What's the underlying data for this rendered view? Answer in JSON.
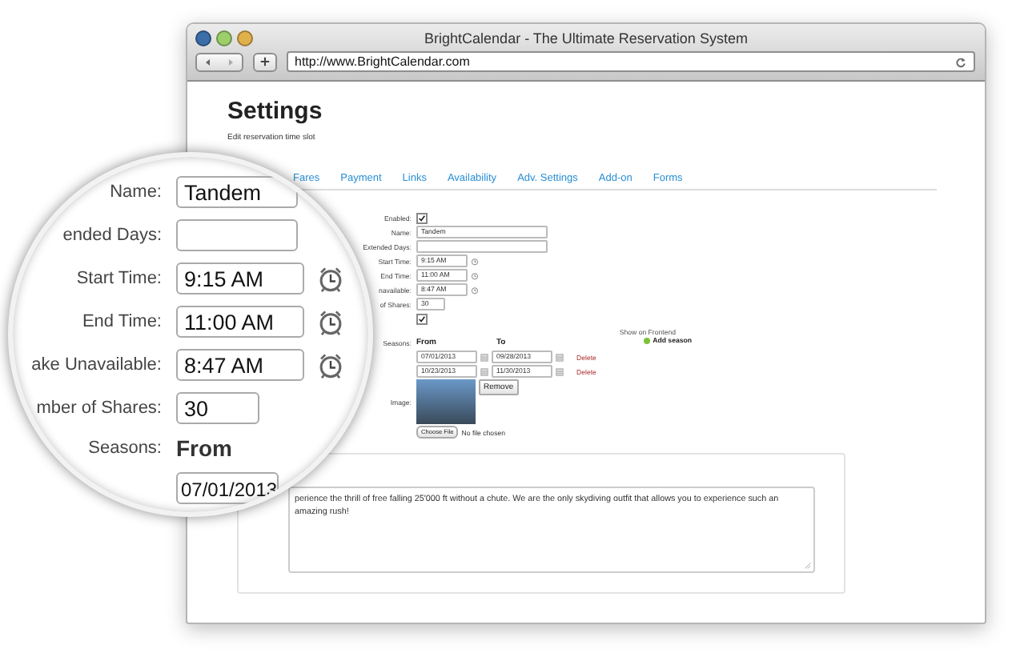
{
  "window": {
    "title": "BrightCalendar - The Ultimate Reservation System",
    "url": "http://www.BrightCalendar.com"
  },
  "page": {
    "heading": "Settings",
    "subtitle": "Edit reservation time slot"
  },
  "tabs": [
    {
      "label": "Fares",
      "selected": false
    },
    {
      "label": "Payment",
      "selected": false
    },
    {
      "label": "Links",
      "selected": false
    },
    {
      "label": "Availability",
      "selected": false
    },
    {
      "label": "Adv. Settings",
      "selected": false
    },
    {
      "label": "Add-on",
      "selected": false
    },
    {
      "label": "Forms",
      "selected": false
    }
  ],
  "form": {
    "fields": [
      {
        "kind": "checkbox",
        "label": "Enabled:",
        "checked": true
      },
      {
        "kind": "text",
        "label": "Name:",
        "value": "Tandem"
      },
      {
        "kind": "text",
        "label": "Extended Days:"
      },
      {
        "kind": "time",
        "label": "Start Time:",
        "value": "9:15 AM"
      },
      {
        "kind": "time",
        "label": "End Time:",
        "value": "11:00 AM"
      },
      {
        "kind": "time",
        "label": "navailable:",
        "value": "8:47 AM"
      },
      {
        "kind": "short",
        "label": "of Shares:",
        "value": "30"
      },
      {
        "kind": "checkbox",
        "checked": true
      }
    ],
    "show_on_frontend": "Show on Frontend",
    "add_season": "Add season",
    "seasons": {
      "label": "Seasons:",
      "from_heading": "From",
      "to_heading": "To",
      "rows": [
        {
          "from": "07/01/2013",
          "to": "09/28/2013",
          "action": "Delete"
        },
        {
          "from": "10/23/2013",
          "to": "11/30/2013",
          "action": "Delete"
        }
      ]
    },
    "image": {
      "label": "Image:",
      "remove": "Remove",
      "choose": "Choose File",
      "file_status": "No file chosen"
    }
  },
  "description": "perience the thrill of free falling 25'000 ft without a chute. We are the only skydiving outfit that allows you to experience such an amazing rush!",
  "magnifier": {
    "fields": [
      {
        "kind": "text",
        "label": "Name:",
        "value": "Tandem"
      },
      {
        "kind": "text",
        "label": "ended Days:"
      },
      {
        "kind": "time",
        "label": "Start Time:",
        "value": "9:15 AM"
      },
      {
        "kind": "time",
        "label": "End Time:",
        "value": "11:00 AM"
      },
      {
        "kind": "time",
        "label": "ake Unavailable:",
        "value": "8:47 AM"
      },
      {
        "kind": "short",
        "label": "mber of Shares:",
        "value": "30"
      },
      {
        "kind": "season",
        "label": "Seasons:",
        "heading": "From",
        "value": "07/01/2013"
      }
    ]
  }
}
